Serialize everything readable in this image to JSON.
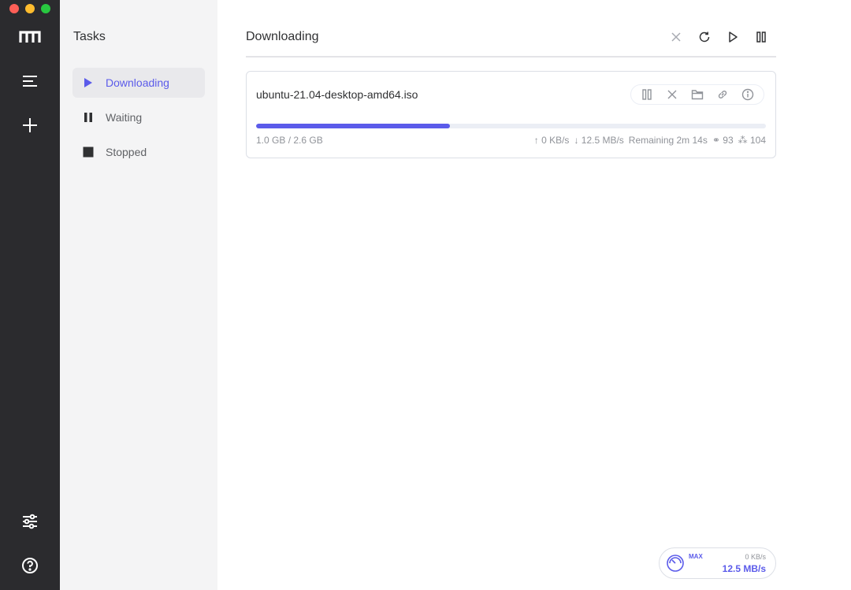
{
  "window": {
    "traffic_lights": [
      "close",
      "minimize",
      "zoom"
    ]
  },
  "rail": {
    "logo_icon": "motrix-logo-icon",
    "items": [
      {
        "name": "menu-icon"
      },
      {
        "name": "add-icon"
      }
    ],
    "bottom": [
      {
        "name": "preferences-icon"
      },
      {
        "name": "help-icon"
      }
    ]
  },
  "sidebar": {
    "title": "Tasks",
    "items": [
      {
        "label": "Downloading",
        "icon": "play-icon",
        "active": true
      },
      {
        "label": "Waiting",
        "icon": "pause-icon",
        "active": false
      },
      {
        "label": "Stopped",
        "icon": "stop-icon",
        "active": false
      }
    ]
  },
  "main": {
    "title": "Downloading",
    "toolbar": [
      "close-icon",
      "refresh-icon",
      "play-icon",
      "pause-icon"
    ]
  },
  "task": {
    "name": "ubuntu-21.04-desktop-amd64.iso",
    "size": "1.0 GB / 2.6 GB",
    "progress": 0.38,
    "upload_speed": "↑ 0 KB/s",
    "download_speed": "↓ 12.5 MB/s",
    "remaining": "Remaining 2m 14s",
    "seeders": "93",
    "connections": "104",
    "actions": [
      "pause-icon",
      "delete-icon",
      "folder-icon",
      "link-icon",
      "info-icon"
    ]
  },
  "speedometer": {
    "mode": "MAX",
    "upload": "0 KB/s",
    "download": "12.5 MB/s"
  },
  "colors": {
    "accent": "#5b5bea",
    "rail": "#2b2b2e",
    "sidebar": "#f4f4f5"
  }
}
